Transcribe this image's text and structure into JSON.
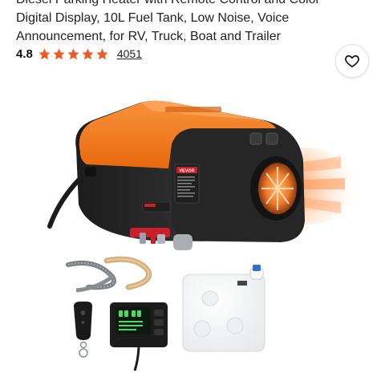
{
  "product": {
    "title_lines": [
      "Diesel Parking Heater with Remote Control and Color",
      "Digital Display, 10L Fuel Tank, Low Noise, Voice",
      "Announcement, for RV, Truck, Boat and Trailer"
    ],
    "rating": "4.8",
    "stars": 5,
    "review_count": "4051",
    "brand_label": "VEVOR"
  },
  "icons": {
    "favorite": "heart-outline-icon",
    "star": "star-filled-icon"
  },
  "colors": {
    "star": "#f05a22",
    "heater_orange": "#f07a1e",
    "heater_body": "#2a2a2a",
    "brand_red": "#c8202a"
  }
}
